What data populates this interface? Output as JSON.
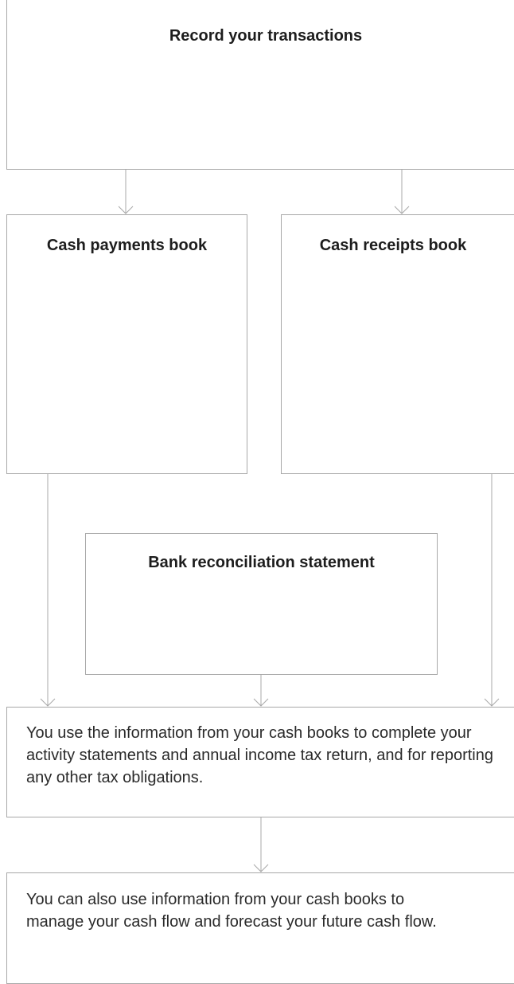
{
  "record_box": {
    "title": "Record your transactions"
  },
  "payments_box": {
    "title": "Cash payments book"
  },
  "receipts_box": {
    "title": "Cash receipts book"
  },
  "bank_box": {
    "title": "Bank reconciliation statement"
  },
  "tax_box": {
    "text": "You use the information from your cash books to complete your activity statements and annual income tax return, and for reporting any other tax obligations."
  },
  "cashflow_box": {
    "text": "You can also use information from your cash books to manage your cash flow and forecast your future cash flow."
  },
  "colors": {
    "border": "#a8a8a8",
    "text": "#222222"
  }
}
